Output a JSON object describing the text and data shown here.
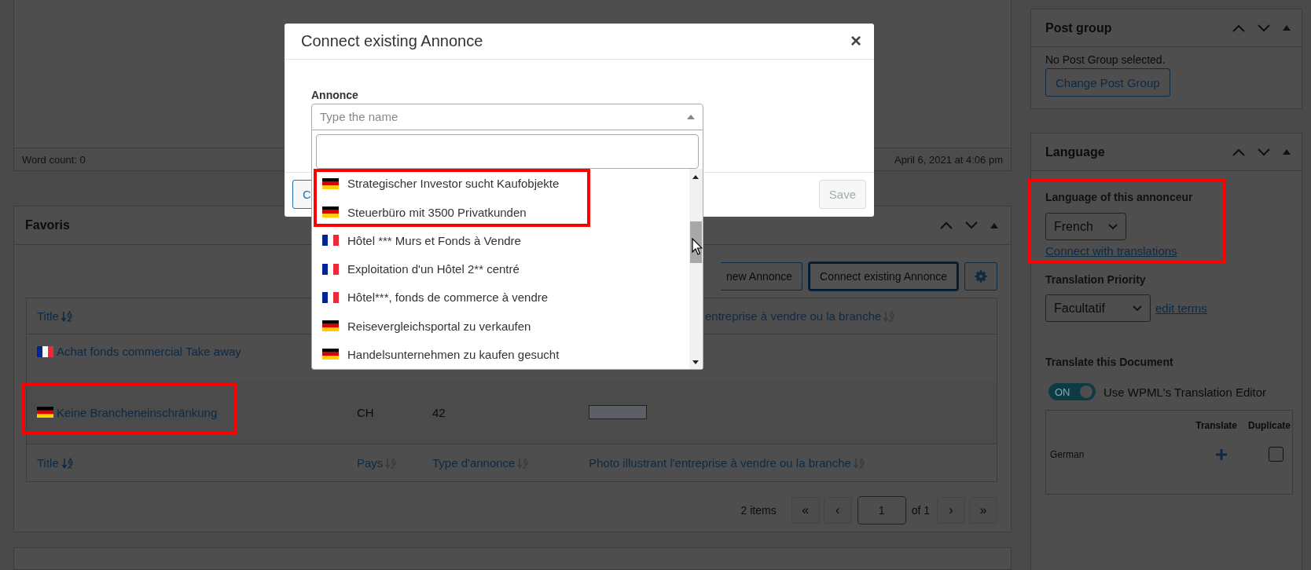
{
  "editor": {
    "word_count": "Word count: 0",
    "last_edited": "April 6, 2021 at 4:06 pm"
  },
  "favoris": {
    "title": "Favoris",
    "buttons": [
      {
        "kind": "text",
        "label": "new Annonce",
        "focused": false
      },
      {
        "kind": "text",
        "label": "Connect existing Annonce",
        "focused": true
      },
      {
        "kind": "gear",
        "focused": false
      }
    ],
    "header_top": [
      {
        "label": "Title",
        "active": true
      },
      {
        "label": "entreprise à vendre ou la branche",
        "active": false
      }
    ],
    "rows": [
      {
        "kind": "fr",
        "title": "Achat fonds commercial Take away",
        "highlighted": false
      },
      {
        "kind": "de",
        "title": "Keine Brancheneinschränkung",
        "pays": "CH",
        "type": "42",
        "photo": true,
        "highlighted": true
      }
    ],
    "header_bottom": [
      {
        "label": "Title",
        "active": true
      },
      {
        "label": "Pays",
        "active": false
      },
      {
        "label": "Type d'annonce",
        "active": false
      },
      {
        "label": "Photo illustrant l'entreprise à vendre ou la branche",
        "active": false
      }
    ],
    "pagination": {
      "count": "2 items",
      "first": "«",
      "prev": "‹",
      "page": "1",
      "of": "of 1",
      "next": "›",
      "last": "»"
    }
  },
  "modal": {
    "title": "Connect existing Annonce",
    "close": "×",
    "field_label": "Annonce",
    "placeholder": "Type the name",
    "options": [
      {
        "kind": "de",
        "label": "Strategischer Investor sucht Kaufobjekte",
        "highlighted": true
      },
      {
        "kind": "de",
        "label": "Steuerbüro mit 3500 Privatkunden",
        "highlighted": true
      },
      {
        "kind": "fr",
        "label": "Hôtel *** Murs et Fonds à Vendre",
        "highlighted": false
      },
      {
        "kind": "fr",
        "label": "Exploitation d'un Hôtel 2** centré",
        "highlighted": false
      },
      {
        "kind": "fr",
        "label": "Hôtel***, fonds de commerce à vendre",
        "highlighted": false
      },
      {
        "kind": "de",
        "label": "Reisevergleichsportal zu verkaufen",
        "highlighted": false
      },
      {
        "kind": "de",
        "label": "Handelsunternehmen zu kaufen gesucht",
        "highlighted": false
      }
    ],
    "buttons": [
      {
        "label": "C",
        "disabled": false
      },
      {
        "label": "Save",
        "disabled": true
      }
    ]
  },
  "sidebar": {
    "post_group": {
      "title": "Post group",
      "text": "No Post Group selected.",
      "button": "Change Post Group"
    },
    "language": {
      "title": "Language",
      "field_label": "Language of this annonceur",
      "value": "French",
      "highlighted": true,
      "link": "Connect with translations",
      "priority_label": "Translation Priority",
      "priority_value": "Facultatif",
      "edit_link": "edit terms",
      "translate_label": "Translate this Document",
      "toggle": {
        "on": true,
        "label": "ON"
      },
      "toggle_text": "Use WPML's Translation Editor",
      "columns": [
        "Translate",
        "Duplicate"
      ],
      "rows": [
        {
          "language": "German",
          "duplicate": false
        }
      ]
    }
  }
}
